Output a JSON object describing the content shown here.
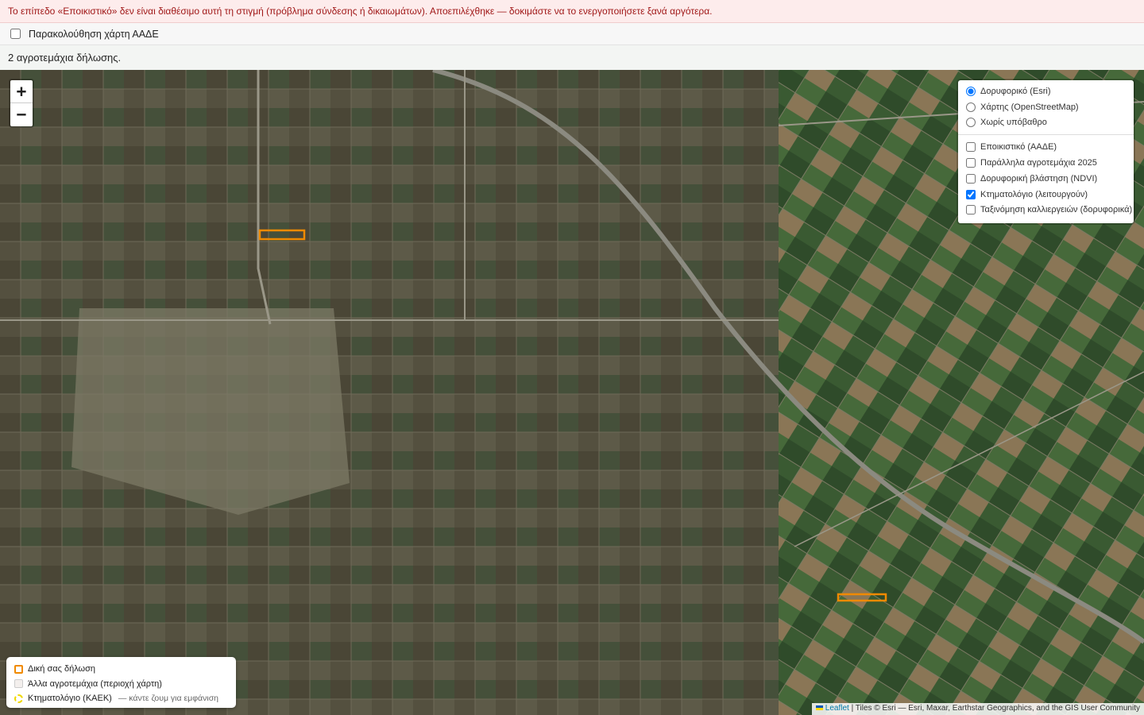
{
  "error_banner": {
    "text": "Το επίπεδο «Εποικιστικό» δεν είναι διαθέσιμο αυτή τη στιγμή (πρόβλημα σύνδεσης ή δικαιωμάτων). Αποεπιλέχθηκε — δοκιμάστε να το ενεργοποιήσετε ξανά αργότερα."
  },
  "watch": {
    "label": "Παρακολούθηση χάρτη ΑΑΔΕ",
    "checked": false
  },
  "status": {
    "count_text": "2 αγροτεμάχια δήλωσης."
  },
  "zoom": {
    "in": "+",
    "out": "−"
  },
  "layers": {
    "base": [
      {
        "label": "Δορυφορικό (Esri)",
        "checked": true
      },
      {
        "label": "Χάρτης (OpenStreetMap)",
        "checked": false
      },
      {
        "label": "Χωρίς υπόβαθρο",
        "checked": false
      }
    ],
    "overlays": [
      {
        "label": "Εποικιστικό (ΑΑΔΕ)",
        "checked": false
      },
      {
        "label": "Παράλληλα αγροτεμάχια 2025",
        "checked": false
      },
      {
        "label": "Δορυφορική βλάστηση (NDVI)",
        "checked": false
      },
      {
        "label": "Κτηματολόγιο (λειτουργούν)",
        "checked": true
      },
      {
        "label": "Ταξινόμηση καλλιεργειών (δορυφορικά)",
        "checked": false
      }
    ]
  },
  "legend": {
    "own": "Δική σας δήλωση",
    "other": "Άλλα αγροτεμάχια (περιοχή χάρτη)",
    "kaek": "Κτηματολόγιο (ΚΑΕΚ)",
    "kaek_hint": "— κάντε ζουμ για εμφάνιση"
  },
  "attribution": {
    "leaflet": "Leaflet",
    "text": " | Tiles © Esri — Esri, Maxar, Earthstar Geographics, and the GIS User Community"
  },
  "colors": {
    "own_parcel": "#f08a00",
    "kaek": "#f0d800",
    "error_text": "#a01818"
  }
}
